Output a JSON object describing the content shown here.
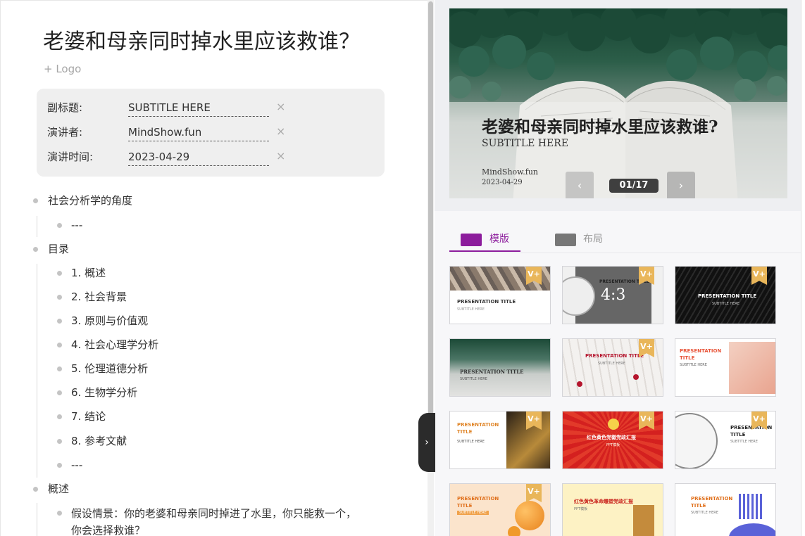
{
  "editor": {
    "title": "老婆和母亲同时掉水里应该救谁？",
    "logo_link": "+ Logo",
    "meta": {
      "subtitle_label": "副标题:",
      "subtitle_value": "SUBTITLE HERE",
      "speaker_label": "演讲者:",
      "speaker_value": "MindShow.fun",
      "date_label": "演讲时间:",
      "date_value": "2023-04-29",
      "clear_icon": "×"
    },
    "outline": [
      {
        "level": 1,
        "text": "社会分析学的角度"
      },
      {
        "level": 2,
        "text": "---"
      },
      {
        "level": 1,
        "text": "目录"
      },
      {
        "level": 2,
        "text": "1. 概述"
      },
      {
        "level": 2,
        "text": "2. 社会背景"
      },
      {
        "level": 2,
        "text": "3. 原则与价值观"
      },
      {
        "level": 2,
        "text": "4. 社会心理学分析"
      },
      {
        "level": 2,
        "text": "5. 伦理道德分析"
      },
      {
        "level": 2,
        "text": "6. 生物学分析"
      },
      {
        "level": 2,
        "text": "7. 结论"
      },
      {
        "level": 2,
        "text": "8. 参考文献"
      },
      {
        "level": 2,
        "text": "---"
      },
      {
        "level": 1,
        "text": "概述"
      },
      {
        "level": 2,
        "text": "假设情景：你的老婆和母亲同时掉进了水里，你只能救一个，你会选择救谁？"
      }
    ]
  },
  "preview": {
    "slide_title": "老婆和母亲同时掉水里应该救谁?",
    "slide_subtitle": "SUBTITLE HERE",
    "slide_author": "MindShow.fun",
    "slide_date": "2023-04-29",
    "page_counter": "01/17",
    "prev_icon": "‹",
    "next_icon": "›"
  },
  "collapse_icon": "›",
  "tabs": {
    "template_label": "模版",
    "layout_label": "布局"
  },
  "templates": [
    {
      "title": "PRESENTATION TITLE",
      "subtitle": "SUBTITLE HERE",
      "vip": true
    },
    {
      "title": "PRESENTATION TITLE",
      "subtitle": "4:3",
      "vip": true
    },
    {
      "title": "PRESENTATION TITLE",
      "subtitle": "SUBTITLE HERE",
      "vip": true
    },
    {
      "title": "PRESENTATION TITLE",
      "subtitle": "SUBTITLE HERE",
      "vip": false
    },
    {
      "title": "PRESENTATION TITLE",
      "subtitle": "SUBTITLE HERE",
      "vip": true
    },
    {
      "title": "PRESENTATION TITLE",
      "subtitle": "SUBTITLE HERE",
      "vip": false
    },
    {
      "title": "PRESENTATION TITLE",
      "subtitle": "SUBTITLE HERE",
      "vip": true
    },
    {
      "title": "红色黄色党徽党政汇报",
      "subtitle": "PPT模板",
      "vip": true
    },
    {
      "title": "PRESENTATION TITLE",
      "subtitle": "SUBTITLE HERE",
      "vip": true
    },
    {
      "title": "PRESENTATION TITLE",
      "subtitle": "SUBTITLE HERE",
      "vip": true
    },
    {
      "title": "红色黄色革命雕塑党政汇报",
      "subtitle": "PPT模板",
      "vip": false
    },
    {
      "title": "PRESENTATION TITLE",
      "subtitle": "SUBTITLE HERE",
      "vip": false
    }
  ],
  "vip_badge": "V+"
}
